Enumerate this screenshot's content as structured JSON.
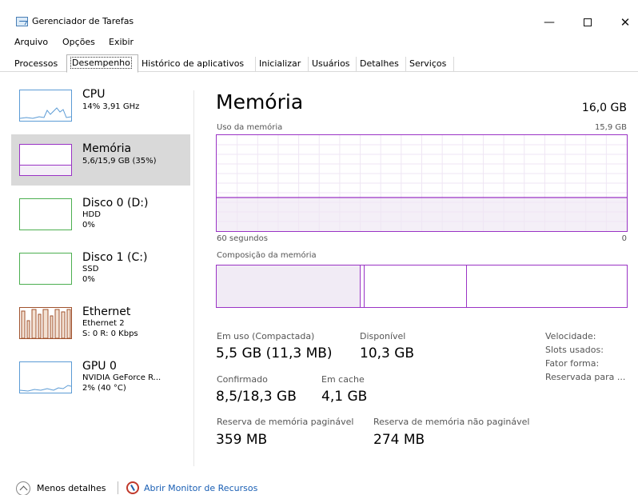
{
  "window": {
    "title": "Gerenciador de Tarefas",
    "minimize": "—",
    "close": "✕"
  },
  "menu": [
    "Arquivo",
    "Opções",
    "Exibir"
  ],
  "tabs": [
    "Processos",
    "Desempenho",
    "Histórico de aplicativos",
    "Inicializar",
    "Usuários",
    "Detalhes",
    "Serviços"
  ],
  "active_tab": "Desempenho",
  "sidebar": {
    "items": [
      {
        "title": "CPU",
        "sub1": "14% 3,91 GHz",
        "sub2": "",
        "icon": "cpu-graph"
      },
      {
        "title": "Memória",
        "sub1": "5,6/15,9 GB (35%)",
        "sub2": "",
        "icon": "memory-graph",
        "selected": true
      },
      {
        "title": "Disco 0 (D:)",
        "sub1": "HDD",
        "sub2": "0%",
        "icon": "disk-graph"
      },
      {
        "title": "Disco 1 (C:)",
        "sub1": "SSD",
        "sub2": "0%",
        "icon": "disk-graph"
      },
      {
        "title": "Ethernet",
        "sub1": "Ethernet 2",
        "sub2": "S: 0 R: 0 Kbps",
        "icon": "ethernet-graph"
      },
      {
        "title": "GPU 0",
        "sub1": "NVIDIA GeForce R...",
        "sub2": "2% (40 °C)",
        "icon": "gpu-graph"
      }
    ]
  },
  "main": {
    "title": "Memória",
    "total": "16,0 GB",
    "usage_label": "Uso da memória",
    "usage_max": "15,9 GB",
    "usage_fraction": 0.35,
    "x_left": "60 segundos",
    "x_right": "0",
    "composition_label": "Composição da memória",
    "composition_fractions": {
      "in_use": 0.35,
      "modified": 0.01,
      "standby": 0.25,
      "free": 0.39
    },
    "stats": {
      "in_use_label": "Em uso (Compactada)",
      "in_use_value": "5,5 GB (11,3 MB)",
      "available_label": "Disponível",
      "available_value": "10,3 GB",
      "committed_label": "Confirmado",
      "committed_value": "8,5/18,3 GB",
      "cached_label": "Em cache",
      "cached_value": "4,1 GB",
      "paged_label": "Reserva de memória paginável",
      "paged_value": "359 MB",
      "nonpaged_label": "Reserva de memória não paginável",
      "nonpaged_value": "274 MB"
    },
    "right_labels": [
      "Velocidade:",
      "Slots usados:",
      "Fator forma:",
      "Reservada para ..."
    ]
  },
  "footer": {
    "less_details": "Menos detalhes",
    "resource_monitor": "Abrir Monitor de Recursos"
  },
  "colors": {
    "memory": "#9a33c5",
    "cpu": "#5b9bd5",
    "disk": "#4caf50",
    "ethernet": "#a0522d",
    "selected_bg": "#d9d9d9",
    "link": "#1a5fb4"
  }
}
